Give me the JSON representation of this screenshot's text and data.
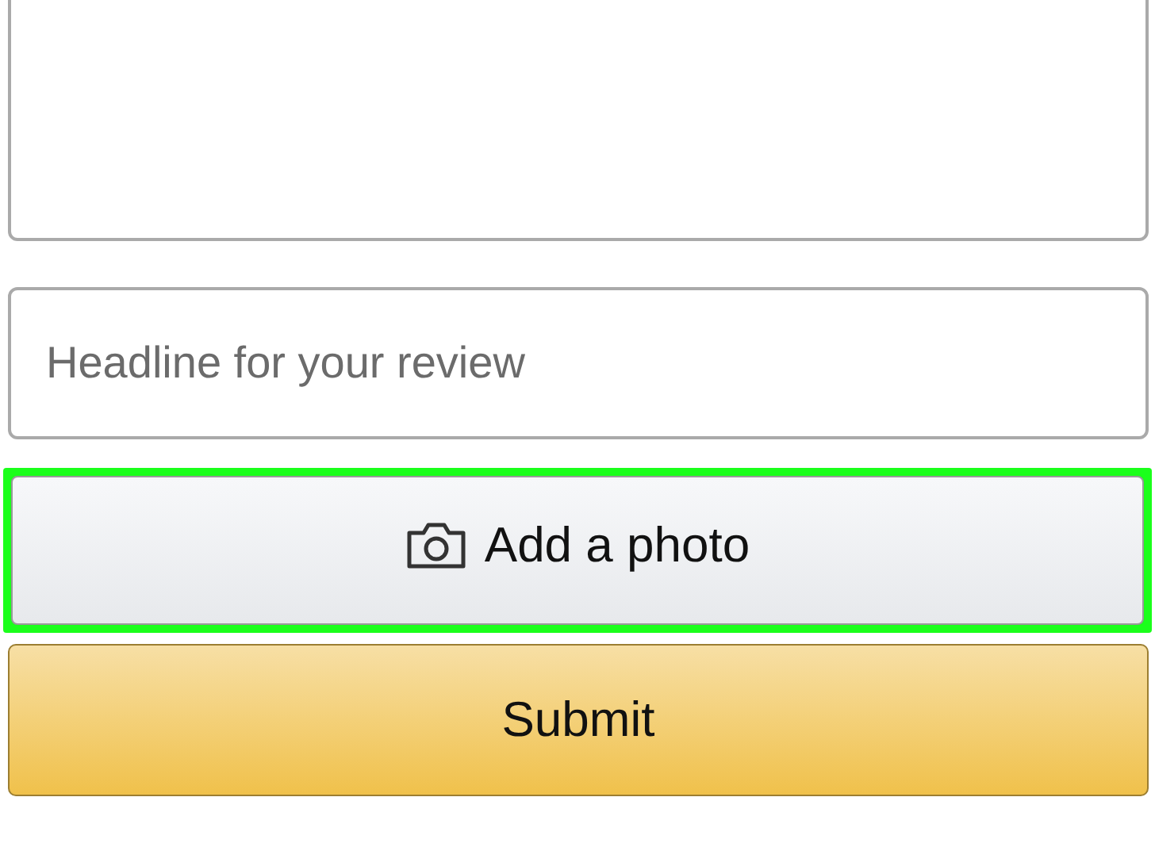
{
  "headline": {
    "placeholder": "Headline for your review"
  },
  "photo_button": {
    "label": "Add a photo",
    "highlighted": true
  },
  "submit_button": {
    "label": "Submit"
  }
}
